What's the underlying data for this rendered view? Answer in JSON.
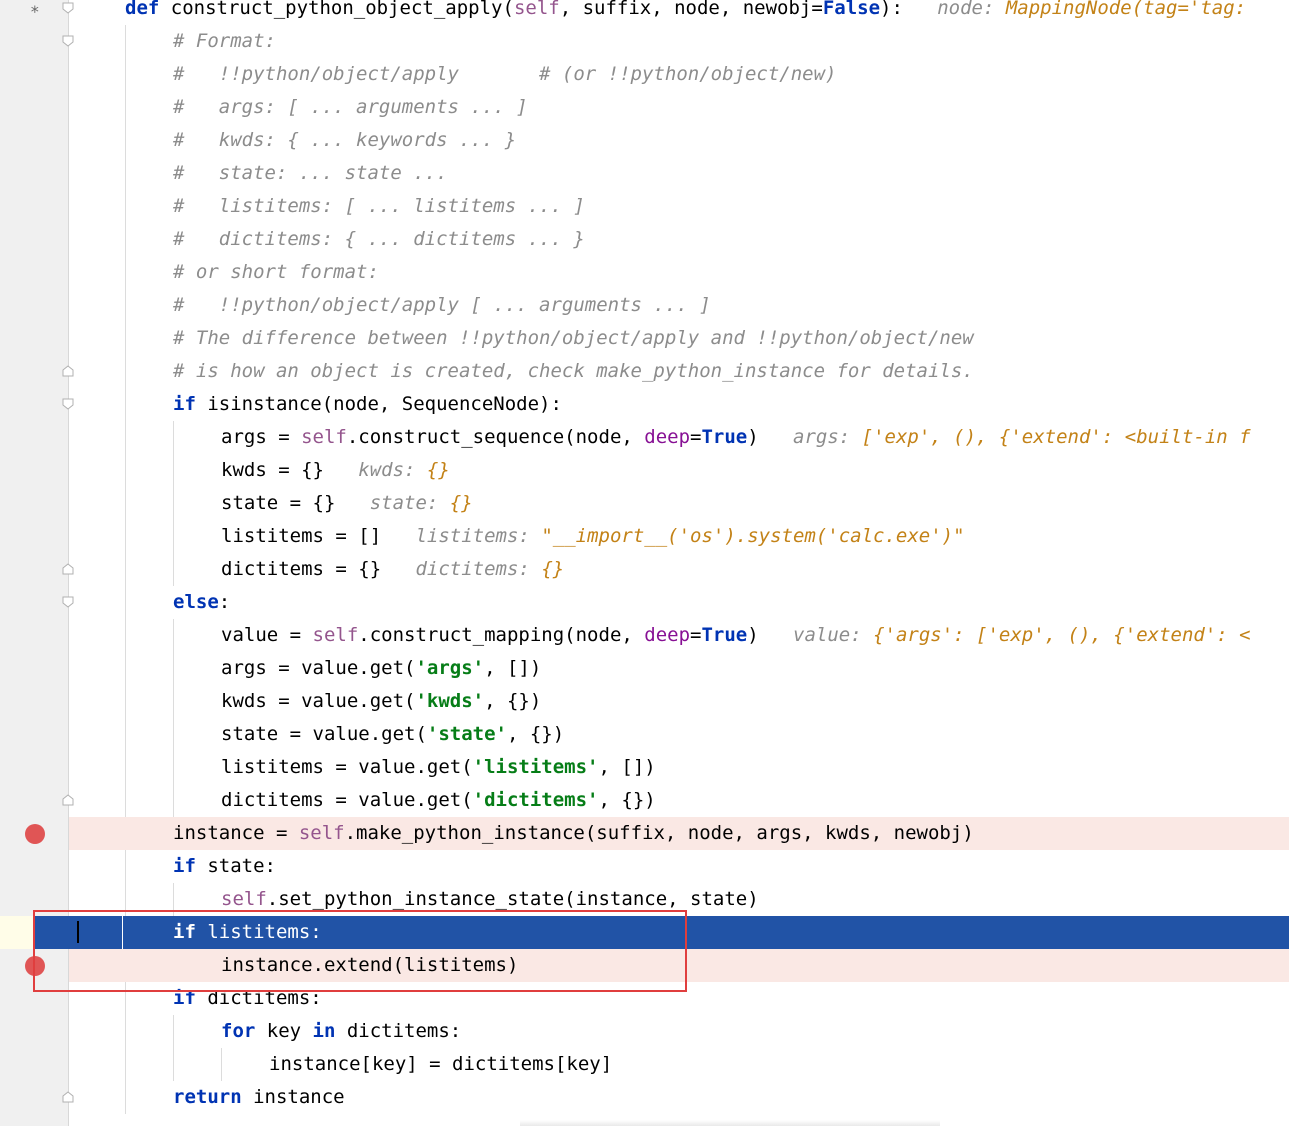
{
  "gutter": {
    "star": "*"
  },
  "lines": [
    [
      [
        "kw",
        "def "
      ],
      [
        "plain",
        "construct_python_object_apply("
      ],
      [
        "self",
        "self"
      ],
      [
        "plain",
        ", suffix, node, newobj="
      ],
      [
        "kw",
        "False"
      ],
      [
        "plain",
        "):  "
      ],
      [
        "inlay",
        " node: "
      ],
      [
        "inlay-val",
        "MappingNode(tag='tag:"
      ]
    ],
    [
      [
        "cm",
        "# Format:"
      ]
    ],
    [
      [
        "cm",
        "#   !!python/object/apply       # (or !!python/object/new)"
      ]
    ],
    [
      [
        "cm",
        "#   args: [ ... arguments ... ]"
      ]
    ],
    [
      [
        "cm",
        "#   kwds: { ... keywords ... }"
      ]
    ],
    [
      [
        "cm",
        "#   state: ... state ..."
      ]
    ],
    [
      [
        "cm",
        "#   listitems: [ ... listitems ... ]"
      ]
    ],
    [
      [
        "cm",
        "#   dictitems: { ... dictitems ... }"
      ]
    ],
    [
      [
        "cm",
        "# or short format:"
      ]
    ],
    [
      [
        "cm",
        "#   !!python/object/apply [ ... arguments ... ]"
      ]
    ],
    [
      [
        "cm",
        "# The difference between !!python/object/apply and !!python/object/new"
      ]
    ],
    [
      [
        "cm",
        "# is how an object is created, check make_python_instance for details."
      ]
    ],
    [
      [
        "kw",
        "if "
      ],
      [
        "plain",
        "isinstance(node, SequenceNode):"
      ]
    ],
    [
      [
        "plain",
        "args = "
      ],
      [
        "self",
        "self"
      ],
      [
        "plain",
        ".construct_sequence(node, "
      ],
      [
        "param",
        "deep"
      ],
      [
        "plain",
        "="
      ],
      [
        "kw",
        "True"
      ],
      [
        "plain",
        ")  "
      ],
      [
        "inlay",
        " args: "
      ],
      [
        "inlay-val",
        "['exp', (), {'extend': <built-in f"
      ]
    ],
    [
      [
        "plain",
        "kwds = {}  "
      ],
      [
        "inlay",
        " kwds: "
      ],
      [
        "inlay-val",
        "{}"
      ]
    ],
    [
      [
        "plain",
        "state = {}  "
      ],
      [
        "inlay",
        " state: "
      ],
      [
        "inlay-val",
        "{}"
      ]
    ],
    [
      [
        "plain",
        "listitems = []  "
      ],
      [
        "inlay",
        " listitems: "
      ],
      [
        "inlay-val",
        "\"__import__('os').system('calc.exe')\""
      ]
    ],
    [
      [
        "plain",
        "dictitems = {}  "
      ],
      [
        "inlay",
        " dictitems: "
      ],
      [
        "inlay-val",
        "{}"
      ]
    ],
    [
      [
        "kw",
        "else"
      ],
      [
        "plain",
        ":"
      ]
    ],
    [
      [
        "plain",
        "value = "
      ],
      [
        "self",
        "self"
      ],
      [
        "plain",
        ".construct_mapping(node, "
      ],
      [
        "param",
        "deep"
      ],
      [
        "plain",
        "="
      ],
      [
        "kw",
        "True"
      ],
      [
        "plain",
        ")  "
      ],
      [
        "inlay",
        " value: "
      ],
      [
        "inlay-val",
        "{'args': ['exp', (), {'extend': <"
      ]
    ],
    [
      [
        "plain",
        "args = value.get("
      ],
      [
        "str",
        "'args'"
      ],
      [
        "plain",
        ", [])"
      ]
    ],
    [
      [
        "plain",
        "kwds = value.get("
      ],
      [
        "str",
        "'kwds'"
      ],
      [
        "plain",
        ", {})"
      ]
    ],
    [
      [
        "plain",
        "state = value.get("
      ],
      [
        "str",
        "'state'"
      ],
      [
        "plain",
        ", {})"
      ]
    ],
    [
      [
        "plain",
        "listitems = value.get("
      ],
      [
        "str",
        "'listitems'"
      ],
      [
        "plain",
        ", [])"
      ]
    ],
    [
      [
        "plain",
        "dictitems = value.get("
      ],
      [
        "str",
        "'dictitems'"
      ],
      [
        "plain",
        ", {})"
      ]
    ],
    [
      [
        "plain",
        "instance = "
      ],
      [
        "self",
        "self"
      ],
      [
        "plain",
        ".make_python_instance(suffix, node, args, kwds, newobj)"
      ]
    ],
    [
      [
        "kw",
        "if "
      ],
      [
        "plain",
        "state:"
      ]
    ],
    [
      [
        "self",
        "self"
      ],
      [
        "plain",
        ".set_python_instance_state(instance, state)"
      ]
    ],
    [
      [
        "kw",
        "if "
      ],
      [
        "plain",
        "listitems:"
      ]
    ],
    [
      [
        "plain",
        "instance.extend(listitems)"
      ]
    ],
    [
      [
        "kw",
        "if "
      ],
      [
        "plain",
        "dictitems:"
      ]
    ],
    [
      [
        "kw",
        "for "
      ],
      [
        "plain",
        "key "
      ],
      [
        "kw",
        "in "
      ],
      [
        "plain",
        "dictitems:"
      ]
    ],
    [
      [
        "plain",
        "instance[key] = dictitems[key]"
      ]
    ],
    [
      [
        "kw",
        "return "
      ],
      [
        "plain",
        "instance"
      ]
    ]
  ]
}
